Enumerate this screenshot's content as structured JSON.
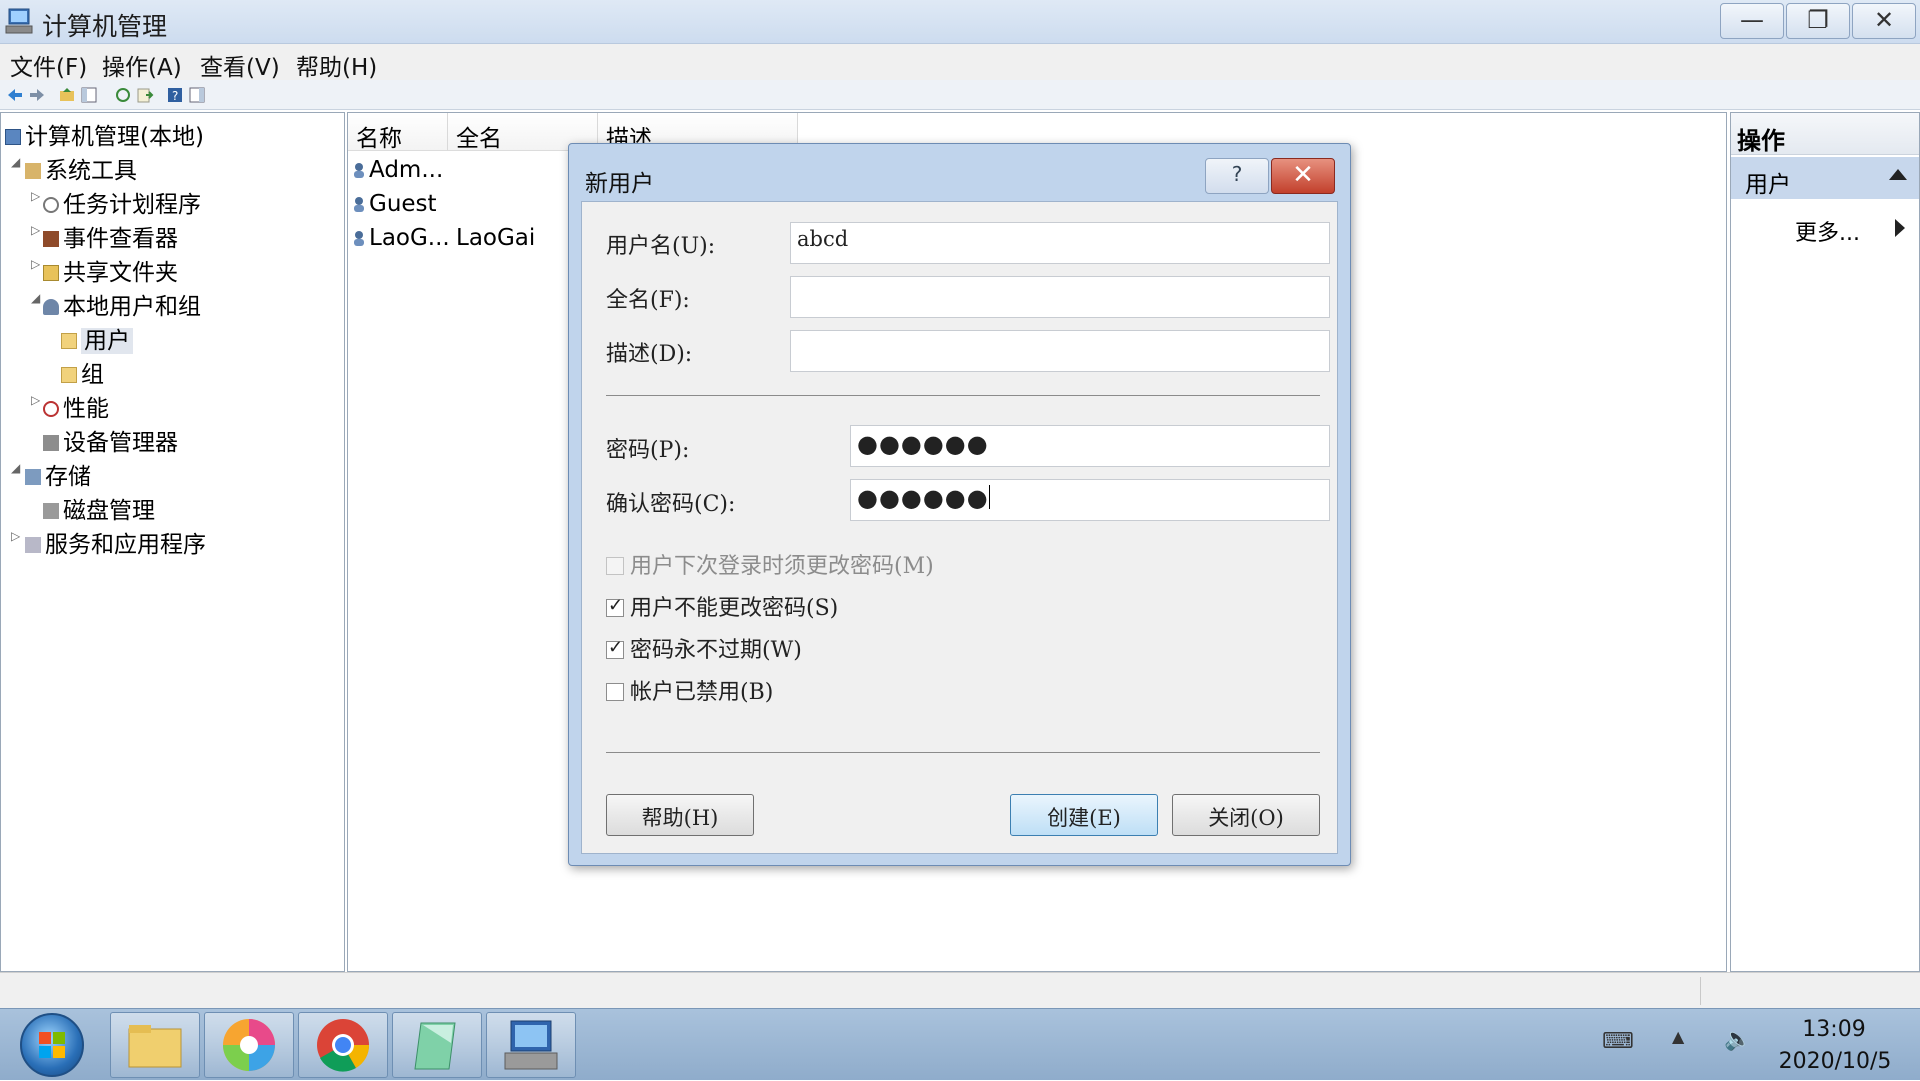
{
  "window": {
    "title": "计算机管理",
    "minimize_glyph": "—",
    "restore_glyph": "❐",
    "close_glyph": "✕"
  },
  "menu": [
    "文件(F)",
    "操作(A)",
    "查看(V)",
    "帮助(H)"
  ],
  "tree": {
    "root": "计算机管理(本地)",
    "system_tools": "系统工具",
    "task_scheduler": "任务计划程序",
    "event_viewer": "事件查看器",
    "shared_folders": "共享文件夹",
    "local_users_groups": "本地用户和组",
    "users": "用户",
    "groups": "组",
    "performance": "性能",
    "device_manager": "设备管理器",
    "storage": "存储",
    "disk_management": "磁盘管理",
    "services_apps": "服务和应用程序"
  },
  "list": {
    "columns": [
      "名称",
      "全名",
      "描述"
    ],
    "rows": [
      {
        "name": "Adm...",
        "fullname": ""
      },
      {
        "name": "Guest",
        "fullname": ""
      },
      {
        "name": "LaoG...",
        "fullname": "LaoGai"
      }
    ]
  },
  "actions": {
    "header": "操作",
    "section": "用户",
    "more": "更多..."
  },
  "dialog": {
    "title": "新用户",
    "help_glyph": "?",
    "close_glyph": "✕",
    "username_label": "用户名(U):",
    "username_value": "abcd",
    "fullname_label": "全名(F):",
    "fullname_value": "",
    "description_label": "描述(D):",
    "description_value": "",
    "password_label": "密码(P):",
    "password_value": "●●●●●●",
    "confirm_label": "确认密码(C):",
    "confirm_value": "●●●●●●",
    "must_change": {
      "label": "用户下次登录时须更改密码(M)",
      "checked": false,
      "disabled": true
    },
    "cannot_change": {
      "label": "用户不能更改密码(S)",
      "checked": true,
      "disabled": false
    },
    "never_expires": {
      "label": "密码永不过期(W)",
      "checked": true,
      "disabled": false
    },
    "disabled_account": {
      "label": "帐户已禁用(B)",
      "checked": false,
      "disabled": false
    },
    "help_button": "帮助(H)",
    "create_button": "创建(E)",
    "close_button": "关闭(O)",
    "check_glyph": "✓"
  },
  "taskbar": {
    "time": "13:09",
    "date": "2020/10/5"
  },
  "colors": {
    "accent": "#3c7fb1",
    "title_bg": "#cddcef",
    "close_red": "#c2402c"
  }
}
